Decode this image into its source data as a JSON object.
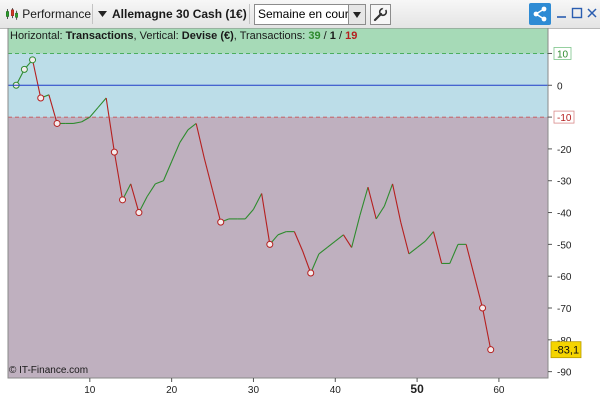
{
  "toolbar": {
    "performance_label": "Performance",
    "instrument_label": "Allemagne 30 Cash (1€)",
    "period_select": "Semaine en cours",
    "icons": [
      "performance-chart-icon",
      "dropdown-arrow-icon",
      "wrench-icon",
      "share-icon",
      "minimize-icon",
      "maximize-icon",
      "close-icon"
    ]
  },
  "header": {
    "horizontal_prefix": "Horizontal: ",
    "horizontal_value": "Transactions",
    "vertical_prefix": ", Vertical: ",
    "vertical_value": "Devise (€)",
    "count_prefix": ", Transactions: ",
    "count_green": "39",
    "slash1": " / ",
    "count_black": "1",
    "slash2": " / ",
    "count_red": "19"
  },
  "watermark": "© IT-Finance.com",
  "colors": {
    "gain_zone": "#a6dab7",
    "neutral_zone": "#bcdde8",
    "loss_zone": "#bfb0bf",
    "gain_line": "#2e8b2e",
    "loss_line": "#b51f1f",
    "zero_line": "#1f3cc8",
    "last_value_bg": "#f5d400"
  },
  "chart_data": {
    "type": "line",
    "x": [
      1,
      2,
      3,
      4,
      5,
      6,
      7,
      8,
      9,
      10,
      11,
      12,
      13,
      14,
      15,
      16,
      17,
      18,
      19,
      20,
      21,
      22,
      23,
      24,
      25,
      26,
      27,
      28,
      29,
      30,
      31,
      32,
      33,
      34,
      35,
      36,
      37,
      38,
      39,
      40,
      41,
      42,
      43,
      44,
      45,
      46,
      47,
      48,
      49,
      50,
      51,
      52,
      53,
      54,
      55,
      56,
      57,
      58,
      59
    ],
    "values": [
      0,
      5,
      8,
      -4,
      -3,
      -12,
      -12,
      -12,
      -11.5,
      -10,
      -7,
      -4,
      -21,
      -36,
      -31,
      -40,
      -35,
      -31,
      -30,
      -24,
      -18,
      -14,
      -12,
      -23,
      -33,
      -43,
      -42,
      -42,
      -42,
      -39,
      -34,
      -50,
      -47,
      -46,
      -46,
      -52,
      -59,
      -53,
      -51,
      -49,
      -47,
      -51,
      -41,
      -32,
      -42,
      -38,
      -31,
      -43,
      -53,
      -51,
      -49,
      -46,
      -56,
      -56,
      -50,
      -50,
      -60,
      -70,
      -83.1
    ],
    "markers_x": [
      1,
      2,
      3,
      4,
      6,
      13,
      14,
      16,
      26,
      32,
      37,
      58,
      59
    ],
    "xticks": [
      10,
      20,
      30,
      40,
      50,
      60
    ],
    "yticks": [
      10,
      0,
      -10,
      -20,
      -30,
      -40,
      -50,
      -60,
      -70,
      -80,
      -90
    ],
    "highlight_xtick": "50",
    "xlim": [
      0,
      66
    ],
    "ylim": [
      -92,
      18
    ],
    "gain_band": [
      10,
      18
    ],
    "neutral_band": [
      -10,
      10
    ],
    "last_value_label": "-83,1"
  }
}
